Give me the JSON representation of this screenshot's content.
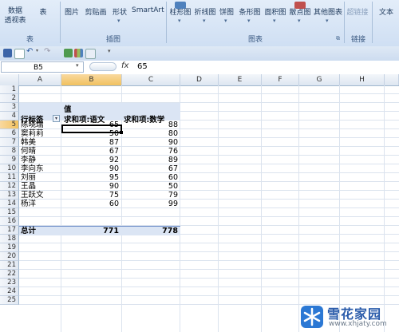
{
  "ribbon": {
    "left_buttons": [
      {
        "label": "数据\n透视表"
      },
      {
        "label": "表"
      }
    ],
    "illustration_buttons": [
      {
        "label": "图片"
      },
      {
        "label": "剪贴画"
      },
      {
        "label": "形状"
      },
      {
        "label": "SmartArt"
      }
    ],
    "chart_buttons": [
      {
        "label": "柱形图"
      },
      {
        "label": "折线图"
      },
      {
        "label": "饼图"
      },
      {
        "label": "条形图"
      },
      {
        "label": "面积图"
      },
      {
        "label": "散点图"
      },
      {
        "label": "其他图表"
      }
    ],
    "link_buttons": [
      {
        "label": "超链接"
      }
    ],
    "text_buttons": [
      {
        "label": "文本"
      }
    ],
    "groups": {
      "table": "表",
      "illustrations": "插图",
      "charts": "图表",
      "links": "链接"
    }
  },
  "formula_bar": {
    "name_box": "B5",
    "fx": "fx",
    "value": "65"
  },
  "columns": [
    "A",
    "B",
    "C",
    "D",
    "E",
    "F",
    "G",
    "H"
  ],
  "rows": [
    "1",
    "2",
    "3",
    "4",
    "5",
    "6",
    "7",
    "8",
    "9",
    "10",
    "11",
    "12",
    "13",
    "14",
    "15",
    "16",
    "17",
    "18",
    "19",
    "20",
    "21",
    "22",
    "23",
    "24",
    "25"
  ],
  "pivot": {
    "values_label": "值",
    "row_label_header": "行标签",
    "col1_header": "求和项:语文",
    "col2_header": "求和项:数学",
    "rows": [
      {
        "name": "陈晓瑞",
        "chinese": "65",
        "math": "88"
      },
      {
        "name": "窦莉莉",
        "chinese": "50",
        "math": "80"
      },
      {
        "name": "韩美",
        "chinese": "87",
        "math": "90"
      },
      {
        "name": "何晴",
        "chinese": "67",
        "math": "76"
      },
      {
        "name": "李静",
        "chinese": "92",
        "math": "89"
      },
      {
        "name": "李向东",
        "chinese": "90",
        "math": "67"
      },
      {
        "name": "刘丽",
        "chinese": "95",
        "math": "60"
      },
      {
        "name": "王晶",
        "chinese": "90",
        "math": "50"
      },
      {
        "name": "王跃文",
        "chinese": "75",
        "math": "79"
      },
      {
        "name": "杨洋",
        "chinese": "60",
        "math": "99"
      }
    ],
    "total_label": "总计",
    "total_chinese": "771",
    "total_math": "778"
  },
  "watermark": {
    "title": "雪花家园",
    "url": "www.xhjaty.com"
  },
  "colors": {
    "accent": "#2b5cab",
    "selection": "#f1c15f",
    "pivot_header": "#dbe5f4"
  }
}
